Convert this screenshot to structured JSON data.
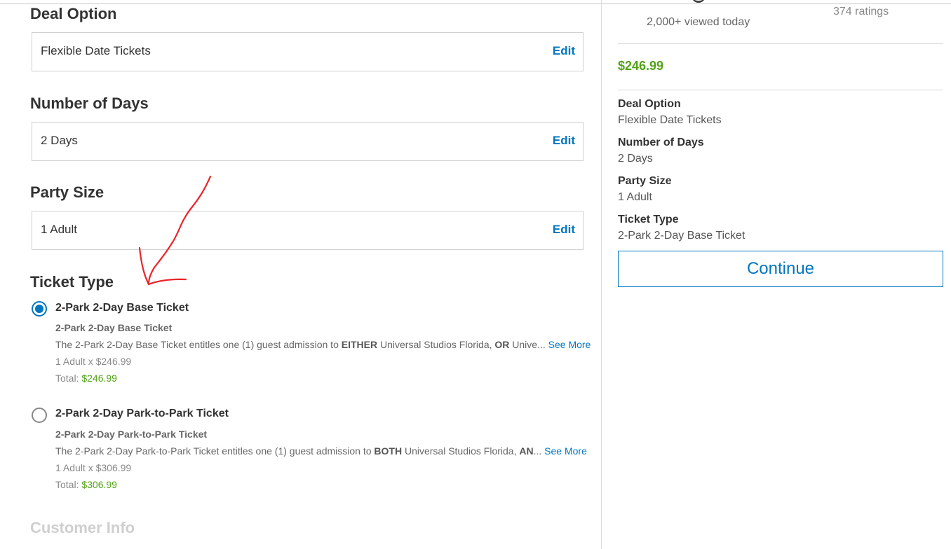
{
  "deal_option": {
    "title": "Deal Option",
    "value": "Flexible Date Tickets",
    "edit_label": "Edit"
  },
  "number_of_days": {
    "title": "Number of Days",
    "value": "2 Days",
    "edit_label": "Edit"
  },
  "party_size": {
    "title": "Party Size",
    "value": "1 Adult",
    "edit_label": "Edit"
  },
  "ticket_type": {
    "title": "Ticket Type",
    "options": [
      {
        "title": "2-Park 2-Day Base Ticket",
        "subtitle": "2-Park 2-Day Base Ticket",
        "desc_prefix": "The 2-Park 2-Day Base Ticket entitles one (1) guest admission to ",
        "desc_bold1": "EITHER",
        "desc_mid": " Universal Studios Florida, ",
        "desc_bold2": "OR",
        "desc_suffix": " Unive...",
        "see_more": "See More",
        "quantity_line": "1 Adult x $246.99",
        "total_label": "Total: ",
        "total_value": "$246.99",
        "selected": true
      },
      {
        "title": "2-Park 2-Day Park-to-Park Ticket",
        "subtitle": "2-Park 2-Day Park-to-Park Ticket",
        "desc_prefix": "The 2-Park 2-Day Park-to-Park Ticket entitles one (1) guest admission to ",
        "desc_bold1": "BOTH",
        "desc_mid": " Universal Studios Florida, ",
        "desc_bold2": "AN",
        "desc_suffix": "...",
        "see_more": "See More",
        "quantity_line": "1 Adult x $306.99",
        "total_label": "Total: ",
        "total_value": "$306.99",
        "selected": false
      }
    ]
  },
  "customer_info": {
    "title": "Customer Info"
  },
  "sidebar": {
    "viewed_today": "2,000+ viewed today",
    "ratings": "374 ratings",
    "price": "$246.99",
    "summary": [
      {
        "label": "Deal Option",
        "value": "Flexible Date Tickets"
      },
      {
        "label": "Number of Days",
        "value": "2 Days"
      },
      {
        "label": "Party Size",
        "value": "1 Adult"
      },
      {
        "label": "Ticket Type",
        "value": "2-Park 2-Day Base Ticket"
      }
    ],
    "continue_label": "Continue"
  },
  "colors": {
    "accent": "#0176c1",
    "price_green": "#53a318",
    "annotation_red": "#e8262b"
  }
}
